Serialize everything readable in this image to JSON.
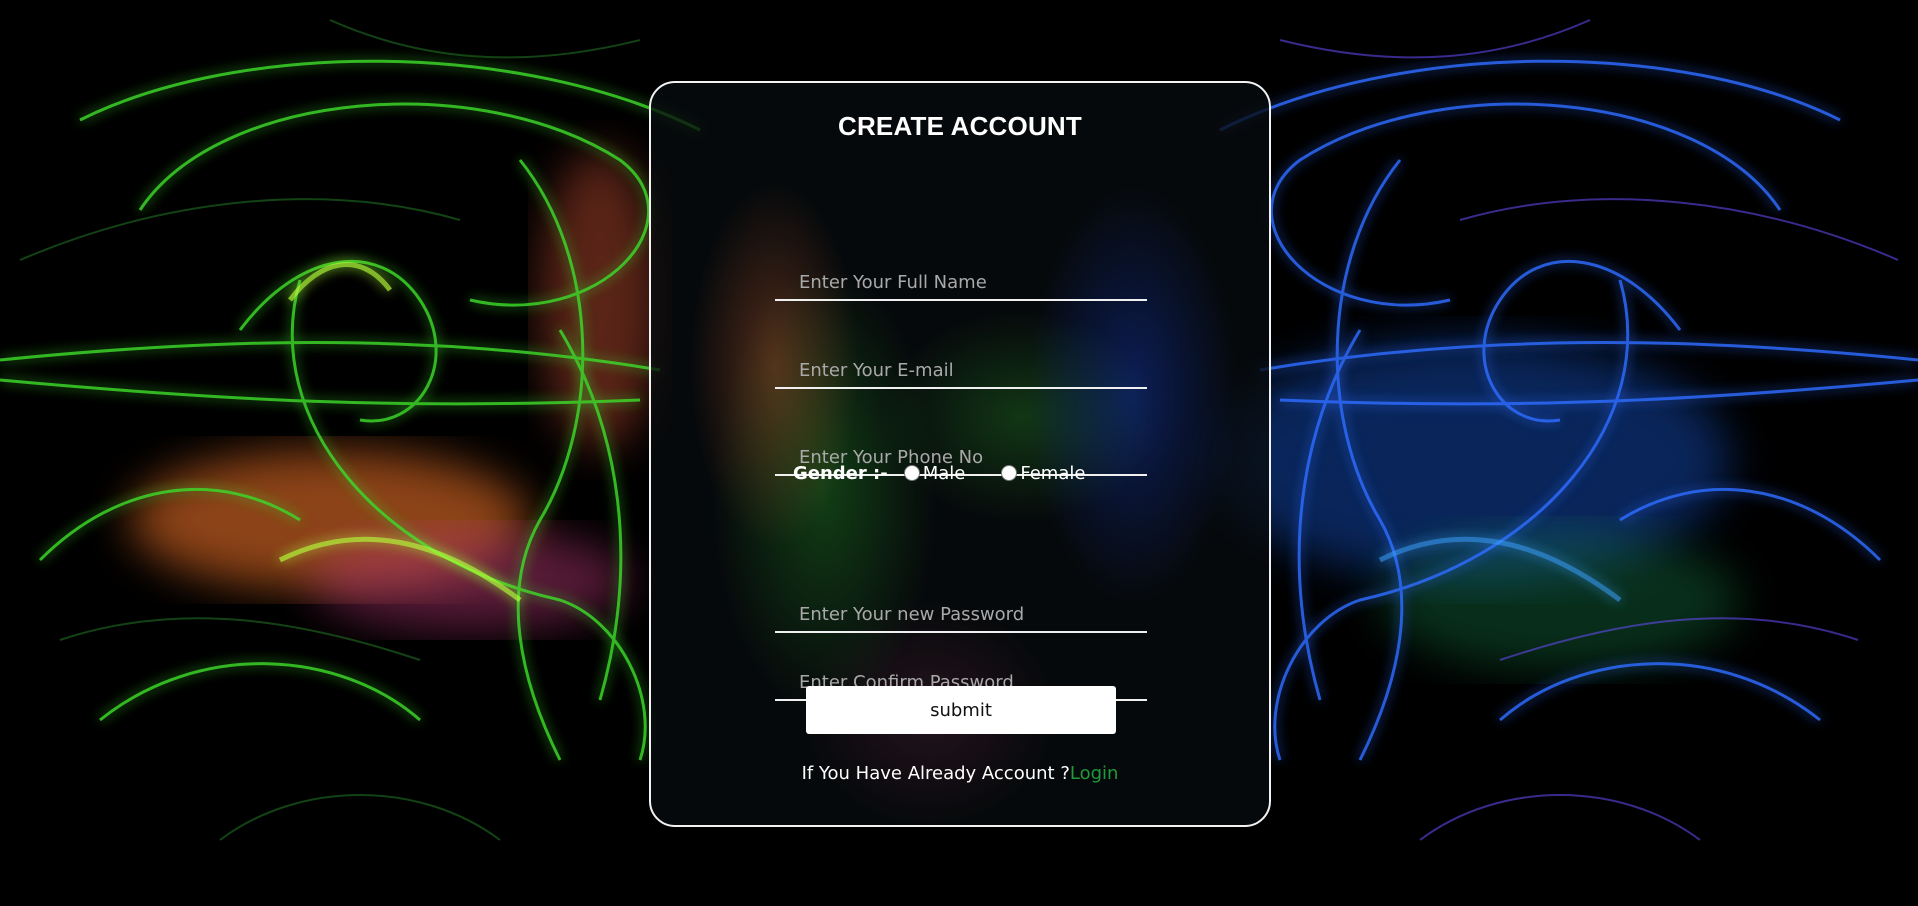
{
  "form": {
    "title": "CREATE ACCOUNT",
    "full_name_placeholder": "Enter Your Full Name",
    "email_placeholder": "Enter Your E-mail",
    "phone_placeholder": "Enter Your Phone No",
    "gender_label": "Gender :-",
    "gender_options": [
      "Male",
      "Female"
    ],
    "password_placeholder": "Enter Your new Password",
    "confirm_password_placeholder": "Enter Confirm Password",
    "submit_label": "submit",
    "login_prompt": "If You Have Already Account ?",
    "login_link": "Login"
  },
  "colors": {
    "page_background": "#000000",
    "card_border": "#f2f2f2",
    "login_link": "#1f9a3a",
    "placeholder": "#a9a9a9"
  }
}
